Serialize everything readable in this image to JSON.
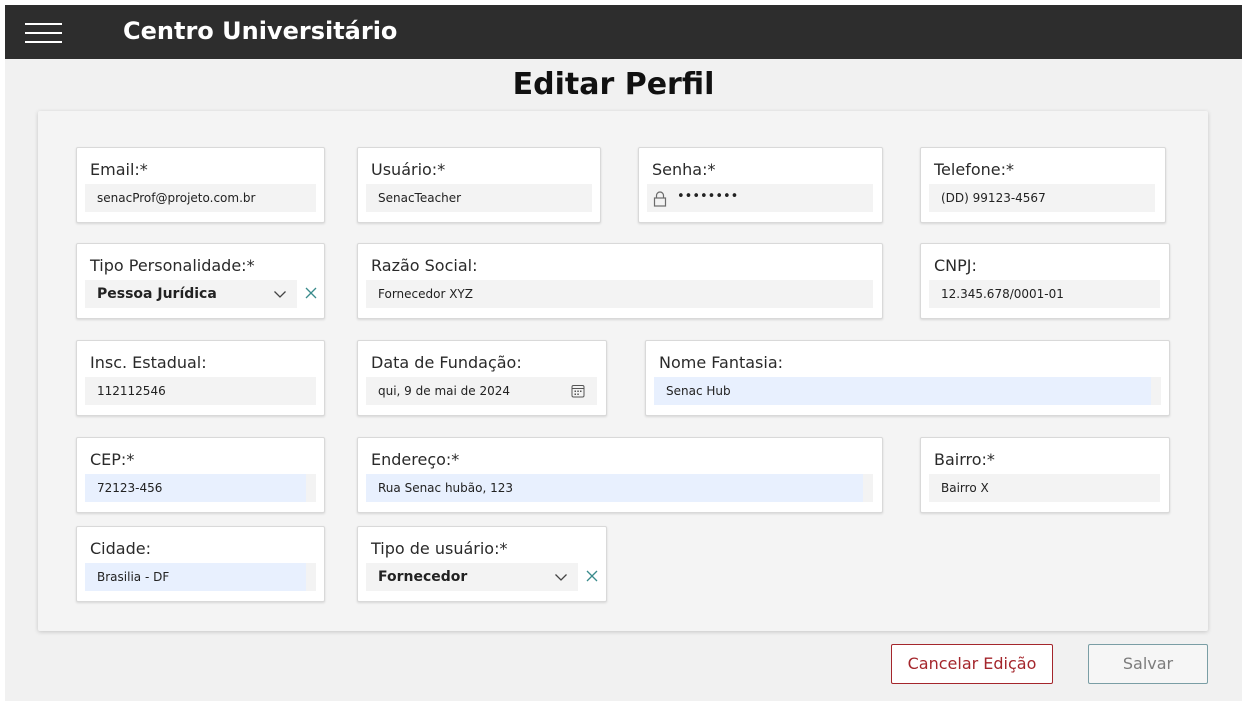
{
  "app": {
    "title": "Centro Universitário"
  },
  "page": {
    "title": "Editar Perfil"
  },
  "fields": {
    "email": {
      "label": "Email:*",
      "value": "senacProf@projeto.com.br"
    },
    "usuario": {
      "label": "Usuário:*",
      "value": "SenacTeacher"
    },
    "senha": {
      "label": "Senha:*",
      "value": "••••••••"
    },
    "telefone": {
      "label": "Telefone:*",
      "value": "(DD) 99123-4567"
    },
    "tipo_personalidade": {
      "label": "Tipo Personalidade:*",
      "value": "Pessoa Jurídica"
    },
    "razao_social": {
      "label": "Razão Social:",
      "value": "Fornecedor XYZ"
    },
    "cnpj": {
      "label": "CNPJ:",
      "value": "12.345.678/0001-01"
    },
    "insc_estadual": {
      "label": "Insc. Estadual:",
      "value": "112112546"
    },
    "data_fundacao": {
      "label": "Data de Fundação:",
      "value": "qui, 9 de mai de 2024"
    },
    "nome_fantasia": {
      "label": "Nome Fantasia:",
      "value": "Senac Hub"
    },
    "cep": {
      "label": "CEP:*",
      "value": "72123-456"
    },
    "endereco": {
      "label": "Endereço:*",
      "value": "Rua Senac hubão, 123"
    },
    "bairro": {
      "label": "Bairro:*",
      "value": "Bairro X"
    },
    "cidade": {
      "label": "Cidade:",
      "value": "Brasilia - DF"
    },
    "tipo_usuario": {
      "label": "Tipo de usuário:*",
      "value": "Fornecedor"
    }
  },
  "buttons": {
    "cancel": "Cancelar Edição",
    "save": "Salvar"
  },
  "icons": {
    "menu": "hamburger-menu-icon",
    "lock": "lock-icon",
    "chevron": "chevron-down-icon",
    "clear": "close-icon",
    "calendar": "calendar-icon"
  },
  "colors": {
    "topbar": "#2d2d2d",
    "cancel": "#a4262c",
    "save_border": "#7a9ea5",
    "clear_icon": "#3a8b8c",
    "autofill": "#e8f0fe"
  }
}
